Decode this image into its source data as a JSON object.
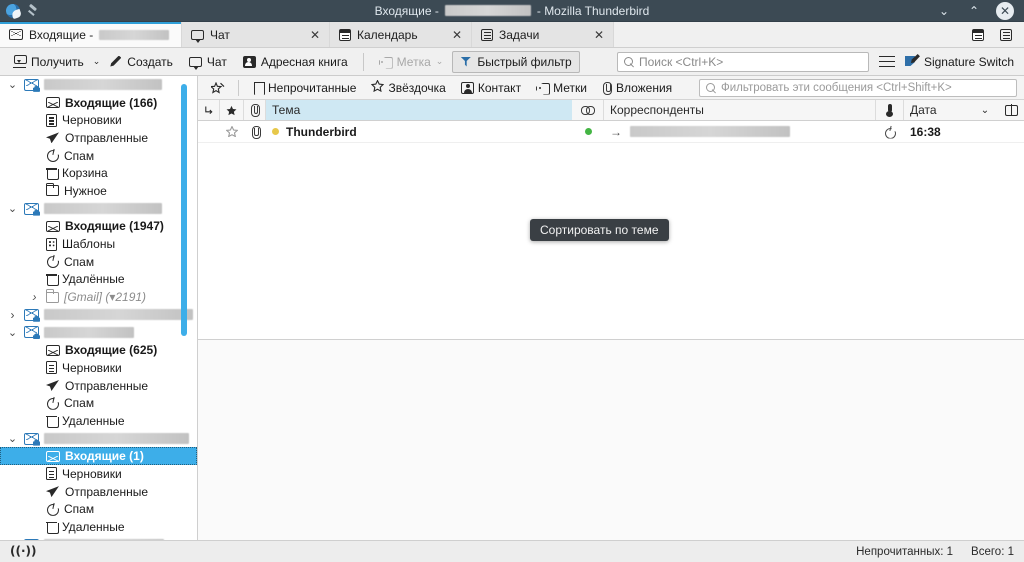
{
  "window": {
    "title_prefix": "Входящие -",
    "title_suffix": "- Mozilla Thunderbird",
    "app_icon": "thunderbird-icon",
    "pin_icon": "pin-icon",
    "minimize_label": "⌄",
    "maximize_label": "⌃",
    "close_label": "✕"
  },
  "tabs": [
    {
      "label": "Входящие -",
      "icon": "envelope-icon",
      "redacted": true,
      "active": true,
      "closable": false
    },
    {
      "label": "Чат",
      "icon": "chat-icon",
      "redacted": false,
      "active": false,
      "closable": true
    },
    {
      "label": "Календарь",
      "icon": "calendar-icon",
      "redacted": false,
      "active": false,
      "closable": true
    },
    {
      "label": "Задачи",
      "icon": "tasks-icon",
      "redacted": false,
      "active": false,
      "closable": true
    }
  ],
  "tabstrip_buttons": [
    {
      "name": "calendar-button",
      "icon": "calendar-icon"
    },
    {
      "name": "tasks-button",
      "icon": "tasks-icon"
    }
  ],
  "toolbar": {
    "get_messages": "Получить",
    "get_messages_caret": "⌄",
    "compose": "Создать",
    "chat": "Чат",
    "address_book": "Адресная книга",
    "tag": "Метка",
    "tag_caret": "⌄",
    "quick_filter": "Быстрый фильтр",
    "search_placeholder": "Поиск <Ctrl+K>",
    "app_menu": "hamburger-icon",
    "signature_switch": "Signature Switch"
  },
  "quickfilter": {
    "pin_label": "",
    "unread": "Непрочитанные",
    "starred": "Звёздочка",
    "contact": "Контакт",
    "tags": "Метки",
    "attachment": "Вложения",
    "filter_placeholder": "Фильтровать эти сообщения <Ctrl+Shift+K>"
  },
  "folder_pane": {
    "scrollbar_color": "#3daee9",
    "items": [
      {
        "label": "",
        "indent": 0,
        "twisty": "v",
        "icon": "account-icon",
        "redacted": true,
        "redact_w": 118,
        "bold": false,
        "selected": false
      },
      {
        "label": "Входящие (166)",
        "indent": 1,
        "twisty": "",
        "icon": "inbox-icon",
        "bold": true,
        "selected": false
      },
      {
        "label": "Черновики",
        "indent": 1,
        "twisty": "",
        "icon": "drafts-icon",
        "bold": false,
        "selected": false
      },
      {
        "label": "Отправленные",
        "indent": 1,
        "twisty": "",
        "icon": "sent-icon",
        "bold": false,
        "selected": false
      },
      {
        "label": "Спам",
        "indent": 1,
        "twisty": "",
        "icon": "spam-icon",
        "bold": false,
        "selected": false
      },
      {
        "label": "Корзина",
        "indent": 1,
        "twisty": "",
        "icon": "trash-icon",
        "bold": false,
        "selected": false
      },
      {
        "label": "Нужное",
        "indent": 1,
        "twisty": "",
        "icon": "folder-icon",
        "bold": false,
        "selected": false
      },
      {
        "label": "",
        "indent": 0,
        "twisty": "v",
        "icon": "account-icon",
        "redacted": true,
        "redact_w": 118,
        "bold": false,
        "selected": false
      },
      {
        "label": "Входящие (1947)",
        "indent": 1,
        "twisty": "",
        "icon": "inbox-icon",
        "bold": true,
        "selected": false
      },
      {
        "label": "Шаблоны",
        "indent": 1,
        "twisty": "",
        "icon": "templates-icon",
        "bold": false,
        "selected": false
      },
      {
        "label": "Спам",
        "indent": 1,
        "twisty": "",
        "icon": "spam-icon",
        "bold": false,
        "selected": false
      },
      {
        "label": "Удалённые",
        "indent": 1,
        "twisty": "",
        "icon": "trash-icon",
        "bold": false,
        "selected": false
      },
      {
        "label": "[Gmail] (▾2191)",
        "indent": 1,
        "twisty": ">",
        "icon": "folder-icon",
        "bold": false,
        "dim": true,
        "selected": false
      },
      {
        "label": "",
        "indent": 0,
        "twisty": ">",
        "icon": "account-icon",
        "redacted": true,
        "redact_w": 150,
        "bold": false,
        "selected": false
      },
      {
        "label": "",
        "indent": 0,
        "twisty": "v",
        "icon": "account-icon",
        "redacted": true,
        "redact_w": 90,
        "bold": false,
        "selected": false
      },
      {
        "label": "Входящие (625)",
        "indent": 1,
        "twisty": "",
        "icon": "inbox-icon",
        "bold": true,
        "selected": false
      },
      {
        "label": "Черновики",
        "indent": 1,
        "twisty": "",
        "icon": "drafts-icon",
        "bold": false,
        "selected": false
      },
      {
        "label": "Отправленные",
        "indent": 1,
        "twisty": "",
        "icon": "sent-icon",
        "bold": false,
        "selected": false
      },
      {
        "label": "Спам",
        "indent": 1,
        "twisty": "",
        "icon": "spam-icon",
        "bold": false,
        "selected": false
      },
      {
        "label": "Удаленные",
        "indent": 1,
        "twisty": "",
        "icon": "trash-icon",
        "bold": false,
        "selected": false
      },
      {
        "label": "",
        "indent": 0,
        "twisty": "v",
        "icon": "account-icon",
        "redacted": true,
        "redact_w": 145,
        "bold": false,
        "selected": false
      },
      {
        "label": "Входящие (1)",
        "indent": 1,
        "twisty": "",
        "icon": "inbox-icon",
        "bold": true,
        "selected": true
      },
      {
        "label": "Черновики",
        "indent": 1,
        "twisty": "",
        "icon": "drafts-icon",
        "bold": false,
        "selected": false
      },
      {
        "label": "Отправленные",
        "indent": 1,
        "twisty": "",
        "icon": "sent-icon",
        "bold": false,
        "selected": false
      },
      {
        "label": "Спам",
        "indent": 1,
        "twisty": "",
        "icon": "spam-icon",
        "bold": false,
        "selected": false
      },
      {
        "label": "Удаленные",
        "indent": 1,
        "twisty": "",
        "icon": "trash-icon",
        "bold": false,
        "selected": false
      },
      {
        "label": "",
        "indent": 0,
        "twisty": "v",
        "icon": "account-icon",
        "redacted": true,
        "redact_w": 120,
        "bold": false,
        "selected": false
      }
    ]
  },
  "message_list": {
    "columns": {
      "thread": "thread-icon",
      "star": "star-icon",
      "attachment": "attachment-icon",
      "subject": "Тема",
      "correspondents_icon": "link-icon",
      "correspondents": "Корреспонденты",
      "spam_icon": "spam-icon",
      "date": "Дата",
      "sort_caret": "⌄",
      "column_picker": "column-picker-icon"
    },
    "rows": [
      {
        "unread_dot": true,
        "star": false,
        "attachment": true,
        "subject": "Thunderbird",
        "correspondent_redacted": true,
        "correspondent_w": 160,
        "direction": "→",
        "date": "16:38",
        "bold": true
      }
    ]
  },
  "tooltip": {
    "text": "Сортировать по теме"
  },
  "statusbar": {
    "connection_icon": "network-icon",
    "unread": "Непрочитанных: 1",
    "total": "Всего: 1"
  }
}
